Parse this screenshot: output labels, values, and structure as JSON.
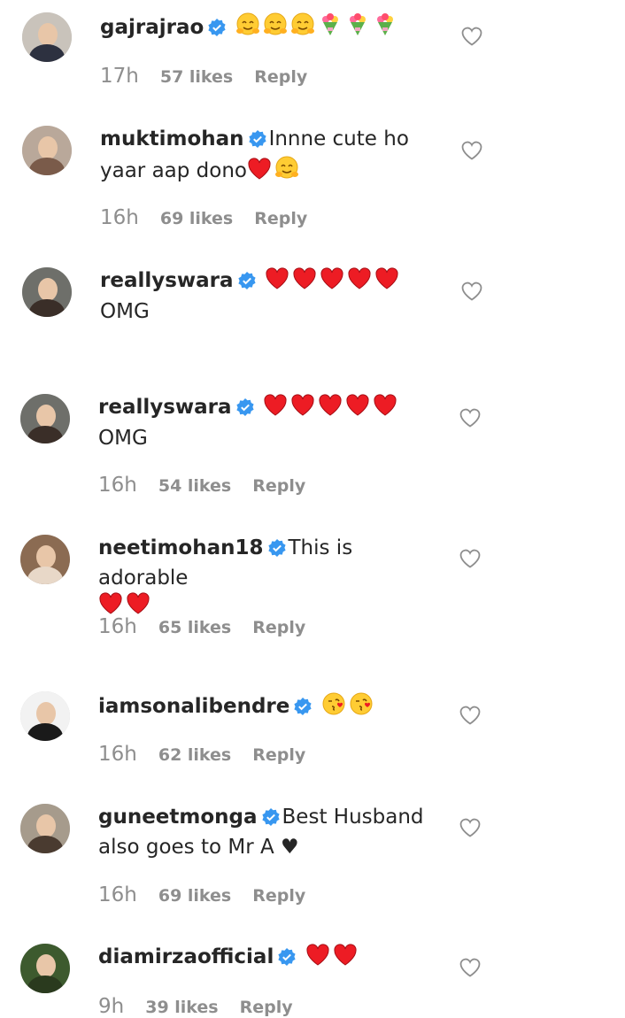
{
  "comments": [
    {
      "username": "gajrajrao",
      "text": "",
      "emojis": [
        "hug",
        "hug",
        "hug",
        "bouquet",
        "bouquet",
        "bouquet"
      ],
      "text_after": "",
      "time": "17h",
      "likes": "57 likes",
      "reply": "Reply",
      "avatar": {
        "bg": "#c9c3bb",
        "body": "#2d3140"
      }
    },
    {
      "username": "muktimohan",
      "text": "Innne cute ho yaar aap dono",
      "emojis": [
        "heart",
        "hug"
      ],
      "text_after": "",
      "time": "16h",
      "likes": "69 likes",
      "reply": "Reply",
      "avatar": {
        "bg": "#b9a89a",
        "body": "#7a5b4a"
      }
    },
    {
      "username": "reallyswara",
      "text": "",
      "emojis": [
        "heart",
        "heart",
        "heart",
        "heart",
        "heart"
      ],
      "text_after": "OMG",
      "time": "",
      "likes": "",
      "reply": "",
      "avatar": {
        "bg": "#6e6f6a",
        "body": "#3a2e28"
      }
    },
    {
      "username": "reallyswara",
      "text": "",
      "emojis": [
        "heart",
        "heart",
        "heart",
        "heart",
        "heart"
      ],
      "text_after": "OMG",
      "time": "16h",
      "likes": "54 likes",
      "reply": "Reply",
      "avatar": {
        "bg": "#6e6f6a",
        "body": "#3a2e28"
      }
    },
    {
      "username": "neetimohan18",
      "text": "This is adorable",
      "emojis": [
        "heart",
        "heart"
      ],
      "text_after": "",
      "time": "16h",
      "likes": "65 likes",
      "reply": "Reply",
      "avatar": {
        "bg": "#8b6b52",
        "body": "#e8d8c8"
      }
    },
    {
      "username": "iamsonalibendre",
      "text": "",
      "emojis": [
        "kiss",
        "kiss"
      ],
      "text_after": "",
      "time": "16h",
      "likes": "62 likes",
      "reply": "Reply",
      "avatar": {
        "bg": "#f2f2f2",
        "body": "#1a1a1a"
      }
    },
    {
      "username": "guneetmonga",
      "text": "Best Husband also goes to Mr A ♥",
      "emojis": [],
      "text_after": "",
      "time": "16h",
      "likes": "69 likes",
      "reply": "Reply",
      "avatar": {
        "bg": "#a69b8c",
        "body": "#4a3b30"
      }
    },
    {
      "username": "diamirzaofficial",
      "text": "",
      "emojis": [
        "heart",
        "heart"
      ],
      "text_after": "",
      "time": "9h",
      "likes": "39 likes",
      "reply": "Reply",
      "avatar": {
        "bg": "#3d5a2e",
        "body": "#2a3a1e"
      }
    }
  ],
  "colors": {
    "text": "#262626",
    "meta": "#8e8e8e",
    "verified": "#3897f0",
    "heart": "#ed1c24"
  }
}
